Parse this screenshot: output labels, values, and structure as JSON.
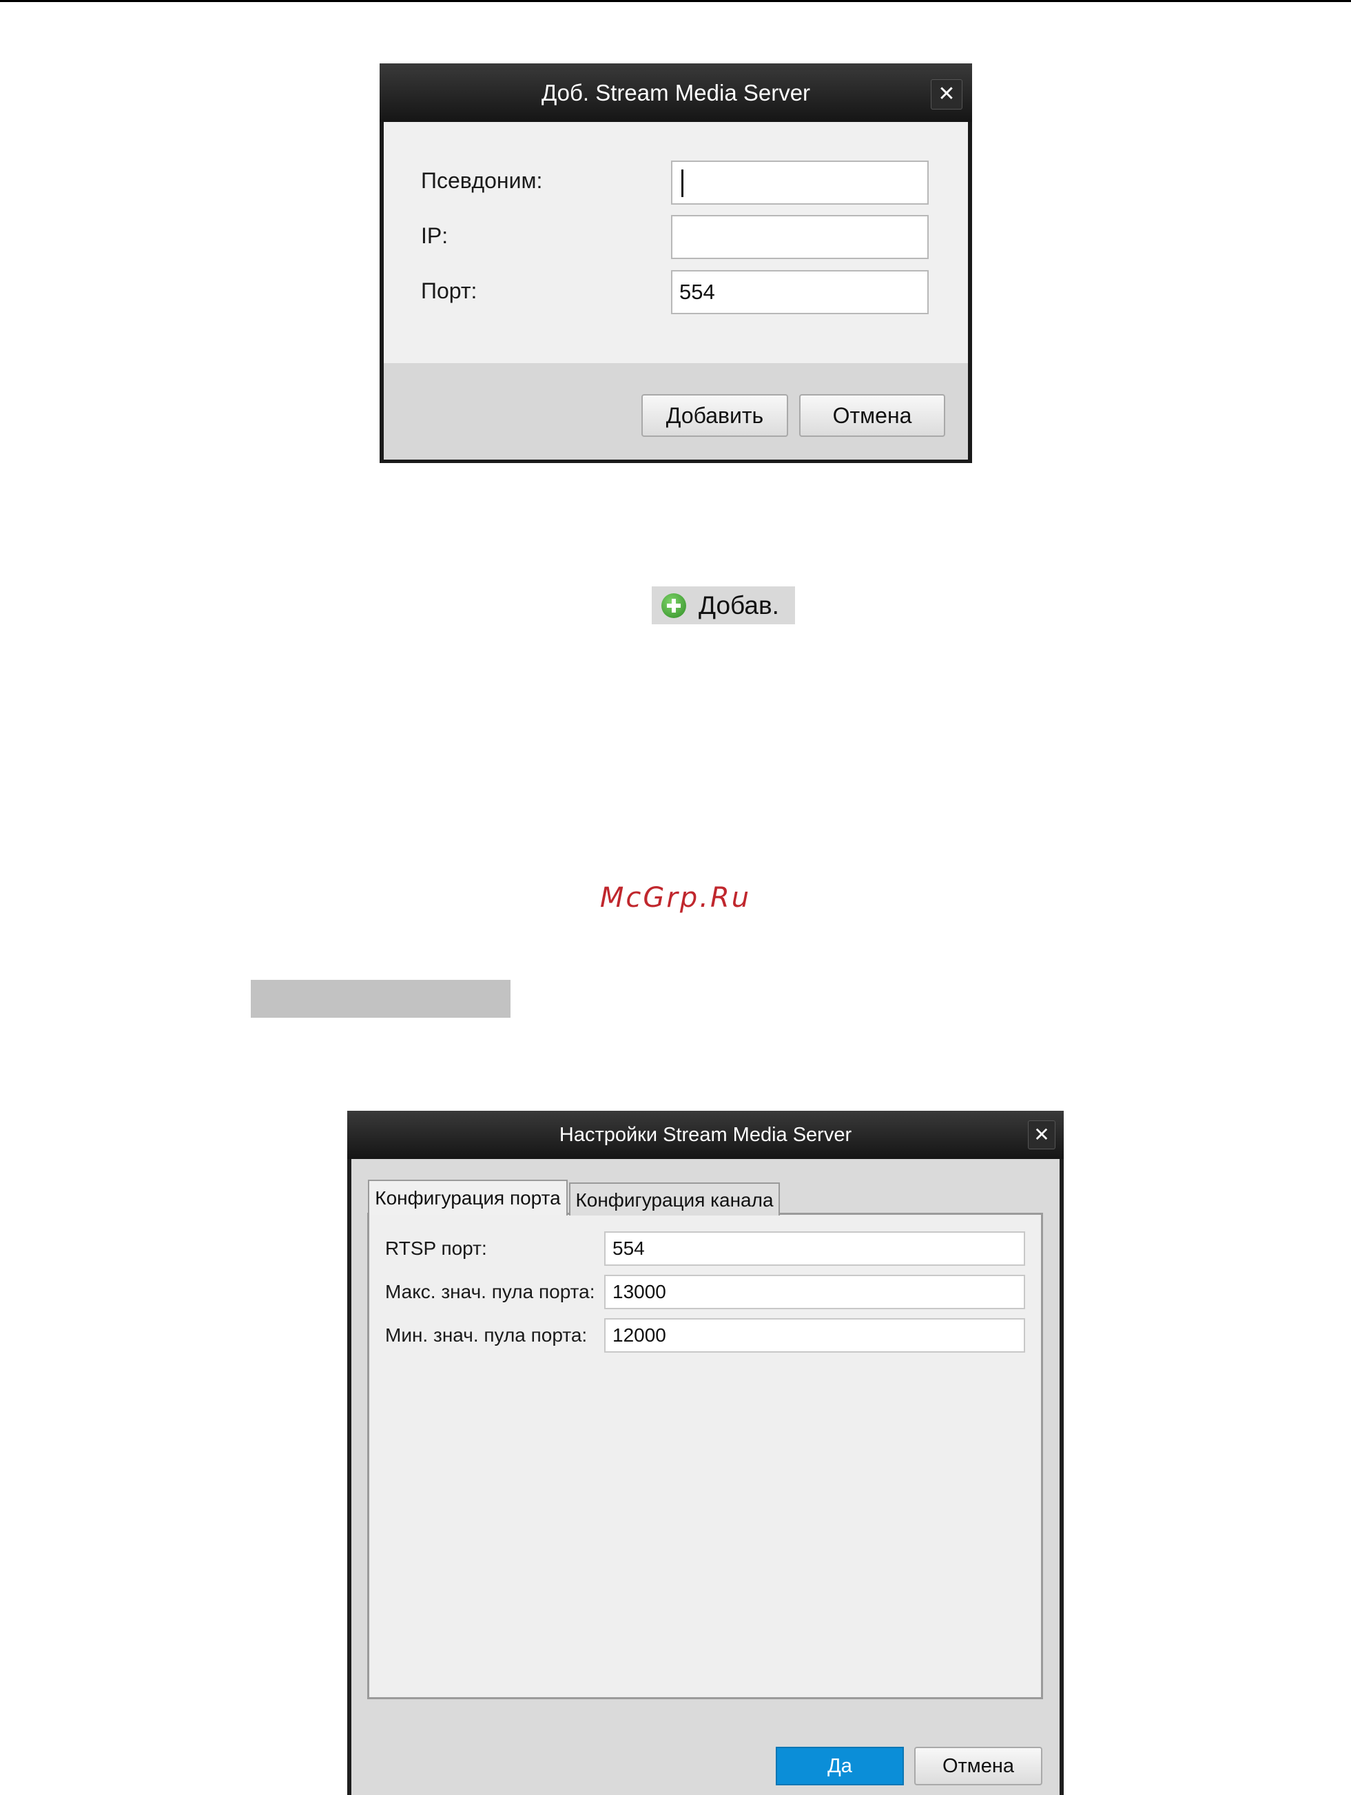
{
  "add_dialog": {
    "title": "Доб. Stream Media Server",
    "close_glyph": "✕",
    "fields": [
      {
        "label": "Псевдоним:",
        "value": "",
        "placeholder": ""
      },
      {
        "label": "IP:",
        "value": "",
        "placeholder": ""
      },
      {
        "label": "Порт:",
        "value": "554",
        "placeholder": ""
      }
    ],
    "add_button": "Добавить",
    "cancel_button": "Отмена"
  },
  "add_toolbar_button": {
    "label": "Добав.",
    "icon": "plus-circle-icon",
    "icon_color": "#3a9b2e"
  },
  "watermark": "McGrp.Ru",
  "settings_dialog": {
    "title": "Настройки Stream Media Server",
    "close_glyph": "✕",
    "tabs": [
      {
        "label": "Конфигурация порта",
        "active": true
      },
      {
        "label": "Конфигурация канала",
        "active": false
      }
    ],
    "fields": [
      {
        "label": "RTSP порт:",
        "value": "554"
      },
      {
        "label": "Макс. знач. пула порта:",
        "value": "13000"
      },
      {
        "label": "Мин. знач. пула порта:",
        "value": "12000"
      }
    ],
    "ok_button": "Да",
    "cancel_button": "Отмена",
    "accent_color": "#0b8ed8"
  }
}
